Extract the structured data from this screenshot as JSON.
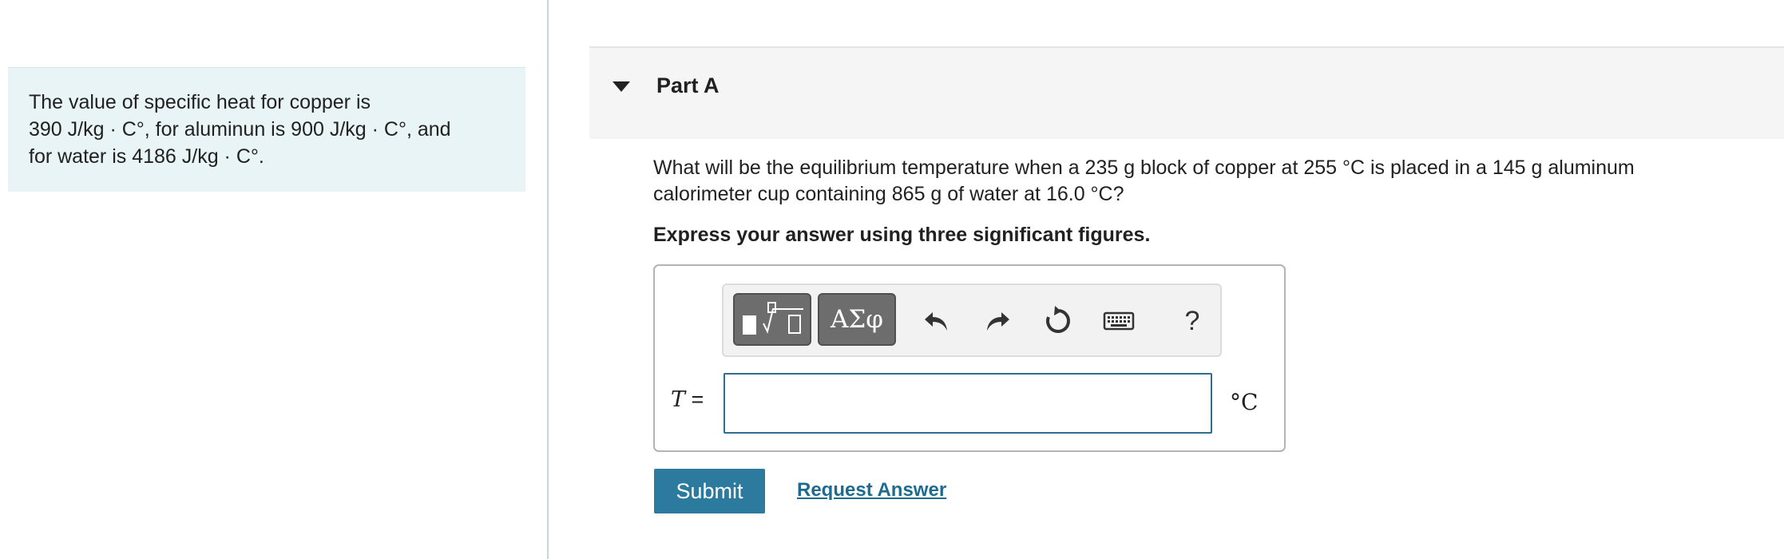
{
  "intro": {
    "lines": [
      "The value of specific heat for copper is",
      "390 J/kg · C°, for aluminun is 900 J/kg · C°, and",
      "for water is 4186 J/kg · C°."
    ]
  },
  "part": {
    "title": "Part A",
    "question_lines": [
      "What will be the equilibrium temperature when a 235  g block of copper at 255 °C is placed in a 145  g aluminum",
      "calorimeter cup containing 865  g of water at 16.0 °C?"
    ],
    "instruction": "Express your answer using three significant figures."
  },
  "toolbar": {
    "greek_label": "ΑΣφ",
    "undo_glyph": "↶",
    "redo_glyph": "↷",
    "reset_glyph": "↻",
    "keyboard_glyph": "⌨",
    "help_label": "?"
  },
  "answer": {
    "variable": "T",
    "equals": "=",
    "value": "",
    "unit": "°C"
  },
  "actions": {
    "submit_label": "Submit",
    "request_answer_label": "Request Answer"
  },
  "colors": {
    "intro_bg": "#e9f4f6",
    "submit_bg": "#2c7a9e",
    "link": "#1f6a8f",
    "input_border": "#2e6e8f"
  },
  "icons": [
    "caret-down-icon",
    "templates-icon",
    "undo-icon",
    "redo-icon",
    "reset-icon",
    "keyboard-icon",
    "help-icon"
  ]
}
